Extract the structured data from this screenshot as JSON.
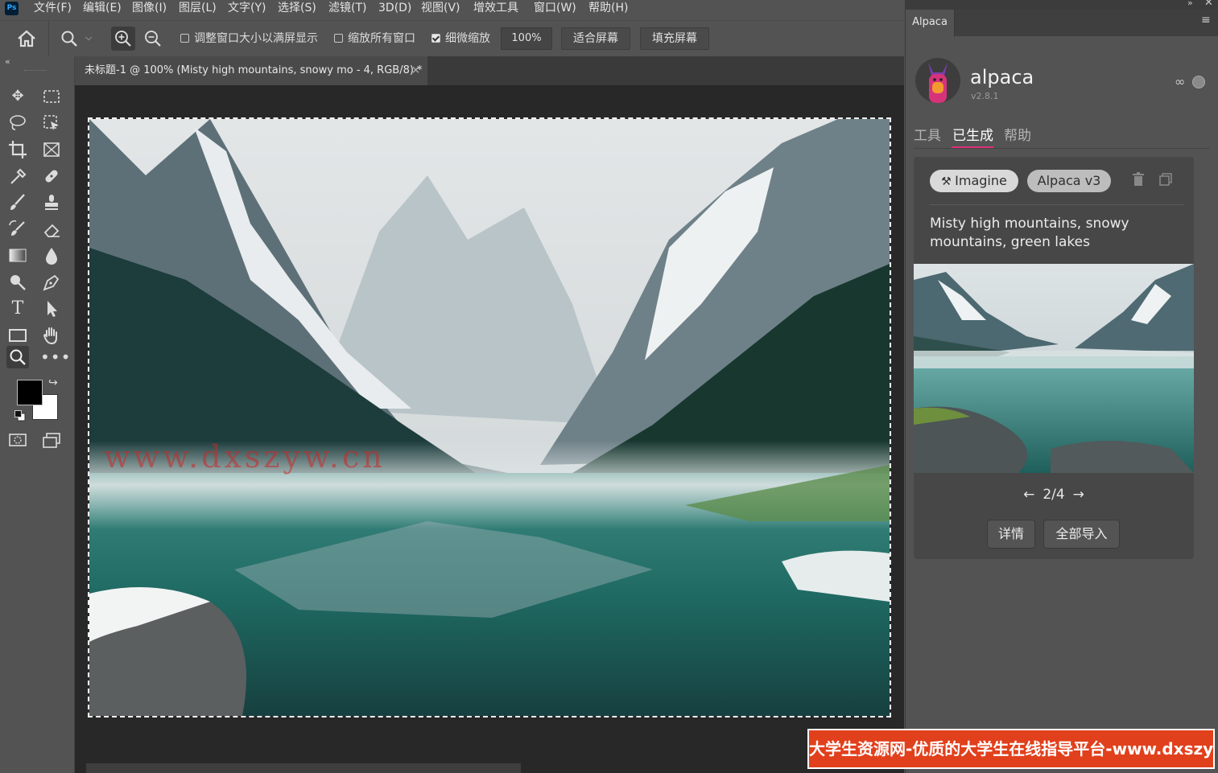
{
  "menubar": {
    "logo": "Ps",
    "items": [
      "文件(F)",
      "编辑(E)",
      "图像(I)",
      "图层(L)",
      "文字(Y)",
      "选择(S)",
      "滤镜(T)",
      "3D(D)",
      "视图(V)",
      "增效工具",
      "窗口(W)",
      "帮助(H)"
    ]
  },
  "options": {
    "resize_windows_label": "调整窗口大小以满屏显示",
    "zoom_all_label": "缩放所有窗口",
    "scrubby_zoom_label": "细微缩放",
    "zoom_value": "100%",
    "fit_screen": "适合屏幕",
    "fill_screen": "填充屏幕"
  },
  "document": {
    "tab_title": "未标题-1 @ 100% (Misty high mountains, snowy mo - 4, RGB/8) *",
    "close": "×",
    "watermark": "www.dxszyw.cn"
  },
  "panel": {
    "tab": "Alpaca",
    "brand": "alpaca",
    "version": "v2.8.1",
    "tabs": [
      "工具",
      "已生成",
      "帮助"
    ],
    "active_tab": "已生成",
    "chips": [
      "Imagine",
      "Alpaca v3"
    ],
    "prompt": "Misty high mountains, snowy mountains, green lakes",
    "pager": "2/4",
    "details_button": "详情",
    "import_all_button": "全部导入"
  },
  "banner": "大学生资源网-优质的大学生在线指导平台-www.dxszyw.cn"
}
